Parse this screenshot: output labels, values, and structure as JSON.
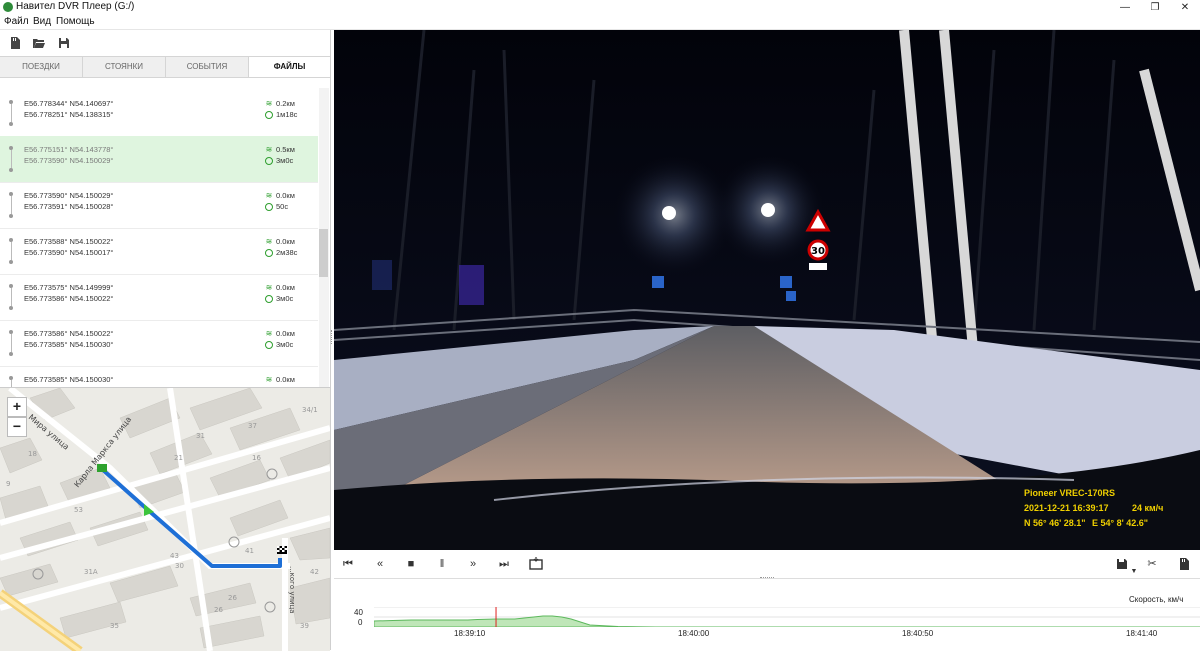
{
  "window": {
    "title": "Навител DVR Плеер (G:/)",
    "minimize": "—",
    "maximize": "❐",
    "close": "✕"
  },
  "menu": [
    "Файл",
    "Вид",
    "Помощь"
  ],
  "toolbar": {
    "icons": [
      "sd-card-icon",
      "folder-open-icon",
      "save-icon"
    ]
  },
  "tabs": [
    {
      "label": "ПОЕЗДКИ",
      "active": false
    },
    {
      "label": "СТОЯНКИ",
      "active": false
    },
    {
      "label": "СОБЫТИЯ",
      "active": false
    },
    {
      "label": "ФАЙЛЫ",
      "active": true
    }
  ],
  "trips": [
    {
      "start": "E56.778344° N54.140697°",
      "end": "E56.778251° N54.138315°",
      "distance": "0.2км",
      "duration": "1м18с",
      "selected": false
    },
    {
      "start": "E56.775151° N54.143778°",
      "end": "E56.773590° N54.150029°",
      "distance": "0.5км",
      "duration": "3м0с",
      "selected": true
    },
    {
      "start": "E56.773590° N54.150029°",
      "end": "E56.773591° N54.150028°",
      "distance": "0.0км",
      "duration": "50с",
      "selected": false
    },
    {
      "start": "E56.773588° N54.150022°",
      "end": "E56.773590° N54.150017°",
      "distance": "0.0км",
      "duration": "2м38с",
      "selected": false
    },
    {
      "start": "E56.773575° N54.149999°",
      "end": "E56.773586° N54.150022°",
      "distance": "0.0км",
      "duration": "3м0с",
      "selected": false
    },
    {
      "start": "E56.773586° N54.150022°",
      "end": "E56.773585° N54.150030°",
      "distance": "0.0км",
      "duration": "3м0с",
      "selected": false
    },
    {
      "start": "E56.773585° N54.150030°",
      "end": "",
      "distance": "0.0км",
      "duration": "",
      "selected": false
    }
  ],
  "map": {
    "zoom_in": "+",
    "zoom_out": "−",
    "streets": [
      "Мира улица",
      "Карла Маркса улица",
      "...кого улица"
    ],
    "house_numbers": [
      "34/1",
      "37",
      "31",
      "16",
      "18",
      "21",
      "9",
      "53",
      "43",
      "41",
      "42",
      "30",
      "31A",
      "35",
      "26",
      "26",
      "39"
    ]
  },
  "video": {
    "osd_model": "Pioneer VREC-170RS",
    "osd_datetime": "2021-12-21 16:39:17",
    "osd_speed": "24 км/ч",
    "osd_lat": "N 56° 46' 28.1\"",
    "osd_lon": "E 54° 8' 42.6\"",
    "sign_speed": "30"
  },
  "controls": {
    "icons": [
      "skip-start-icon",
      "rewind-icon",
      "stop-icon",
      "pause-icon",
      "fast-forward-icon",
      "skip-end-icon",
      "snapshot-icon",
      "save-icon",
      "dropdown-arrow-icon",
      "scissors-icon",
      "sd-card-icon"
    ]
  },
  "chart_data": {
    "type": "area",
    "ylabel": "Скорость, км/ч",
    "ylim": [
      0,
      40
    ],
    "yticks": [
      "40",
      "0"
    ],
    "xticks": [
      "18:39:10",
      "18:40:00",
      "18:40:50",
      "18:41:40"
    ],
    "x_seconds": [
      0,
      20,
      40,
      60,
      80,
      100,
      110,
      130,
      150,
      160,
      170,
      180,
      190,
      200,
      210,
      220,
      230,
      260,
      300,
      340,
      380,
      420,
      460,
      500,
      540,
      580,
      620,
      660,
      700,
      740,
      780,
      820,
      860,
      880
    ],
    "values": [
      12,
      13,
      14,
      14,
      14,
      14,
      15,
      16,
      16,
      18,
      20,
      22,
      22,
      20,
      16,
      10,
      4,
      1,
      0,
      0,
      0,
      0,
      0,
      0,
      0,
      0,
      0,
      0,
      0,
      0,
      0,
      0,
      0,
      0
    ],
    "cursor_x": 130,
    "color": "#5cb85c"
  }
}
